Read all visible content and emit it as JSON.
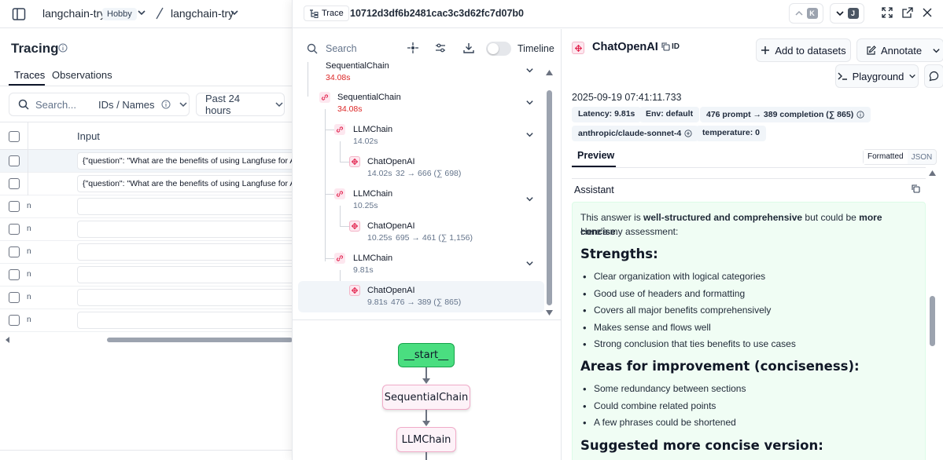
{
  "topbar": {
    "project": "langchain-try",
    "plan_badge": "Hobby",
    "separator": "/",
    "dataset": "langchain-try"
  },
  "left": {
    "title": "Tracing",
    "tabs": [
      "Traces",
      "Observations"
    ],
    "search_placeholder": "Search...",
    "search_scope": "IDs / Names",
    "time_range": "Past 24 hours",
    "column_input": "Input",
    "rows": [
      "{\"question\": \"What are the benefits of using Langfuse for AI",
      "{\"question\": \"What are the benefits of using Langfuse for AI"
    ],
    "empty_row_mark": "n"
  },
  "panel": {
    "trace_label": "Trace",
    "trace_id": "10712d3df6b2481cac3c3d62fc7d07b0",
    "kbd_prev": "K",
    "kbd_next": "J"
  },
  "tree": {
    "search_placeholder": "Search",
    "timeline_label": "Timeline",
    "nodes": [
      {
        "name": "SequentialChain",
        "time": "34.08s"
      },
      {
        "name": "SequentialChain",
        "time": "34.08s"
      },
      {
        "name": "LLMChain",
        "time": "14.02s"
      },
      {
        "name": "ChatOpenAI",
        "time": "14.02s",
        "tokens": "32 → 666 (∑ 698)"
      },
      {
        "name": "LLMChain",
        "time": "10.25s"
      },
      {
        "name": "ChatOpenAI",
        "time": "10.25s",
        "tokens": "695 → 461 (∑ 1,156)"
      },
      {
        "name": "LLMChain",
        "time": "9.81s"
      },
      {
        "name": "ChatOpenAI",
        "time": "9.81s",
        "tokens": "476 → 389 (∑ 865)"
      }
    ]
  },
  "graph": {
    "nodes": [
      "__start__",
      "SequentialChain",
      "LLMChain"
    ]
  },
  "detail": {
    "title": "ChatOpenAI",
    "id_label": "ID",
    "add_to_datasets": "Add to datasets",
    "annotate": "Annotate",
    "playground": "Playground",
    "timestamp": "2025-09-19 07:41:11.733",
    "pills": {
      "latency": "Latency: 9.81s",
      "env": "Env: default",
      "usage": "476 prompt → 389 completion (∑ 865)",
      "model": "anthropic/claude-sonnet-4",
      "temperature": "temperature: 0"
    },
    "tab_preview": "Preview",
    "format_formatted": "Formatted",
    "format_json": "JSON",
    "role": "Assistant",
    "message": {
      "intro_1": "This answer is ",
      "intro_bold_1": "well-structured and comprehensive",
      "intro_2": " but could be ",
      "intro_bold_2": "more concise",
      "intro_3": ".",
      "intro_line2": "Here's my assessment:",
      "h_strengths": "Strengths:",
      "strengths": [
        "Clear organization with logical categories",
        "Good use of headers and formatting",
        "Covers all major benefits comprehensively",
        "Makes sense and flows well",
        "Strong conclusion that ties benefits to use cases"
      ],
      "h_improve": "Areas for improvement (conciseness):",
      "improvements": [
        "Some redundancy between sections",
        "Could combine related points",
        "A few phrases could be shortened"
      ],
      "h_suggested": "Suggested more concise version:"
    }
  }
}
